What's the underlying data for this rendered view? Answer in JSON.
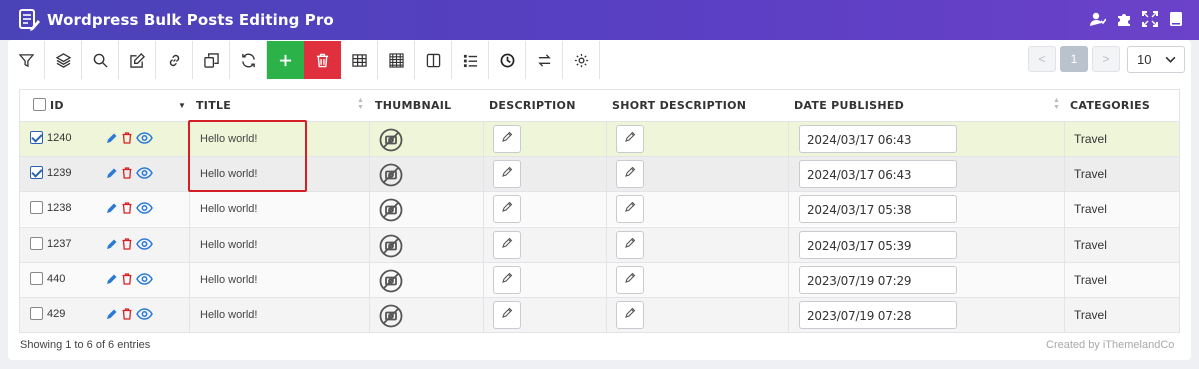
{
  "header": {
    "title": "Wordpress Bulk Posts Editing Pro",
    "icons": [
      "user-settings-icon",
      "puzzle-icon",
      "fullscreen-icon",
      "book-icon"
    ]
  },
  "toolbar": {
    "buttons": [
      "filter-icon",
      "layers-icon",
      "search-icon",
      "edit-icon",
      "link-icon",
      "duplicate-icon",
      "refresh-icon",
      "add-icon",
      "delete-icon",
      "table-icon",
      "grid-icon",
      "columns-icon",
      "list-icon",
      "clock-icon",
      "swap-icon",
      "gear-icon"
    ]
  },
  "pagination": {
    "prev": "<",
    "page": "1",
    "next": ">",
    "per_page": "10"
  },
  "table": {
    "columns": [
      "ID",
      "TITLE",
      "THUMBNAIL",
      "DESCRIPTION",
      "SHORT DESCRIPTION",
      "DATE PUBLISHED",
      "CATEGORIES"
    ],
    "rows": [
      {
        "id": "1240",
        "checked": true,
        "title": "Hello world!",
        "date": "2024/03/17 06:43",
        "category": "Travel"
      },
      {
        "id": "1239",
        "checked": true,
        "title": "Hello world!",
        "date": "2024/03/17 06:43",
        "category": "Travel"
      },
      {
        "id": "1238",
        "checked": false,
        "title": "Hello world!",
        "date": "2024/03/17 05:38",
        "category": "Travel"
      },
      {
        "id": "1237",
        "checked": false,
        "title": "Hello world!",
        "date": "2024/03/17 05:39",
        "category": "Travel"
      },
      {
        "id": "440",
        "checked": false,
        "title": "Hello world!",
        "date": "2023/07/19 07:29",
        "category": "Travel"
      },
      {
        "id": "429",
        "checked": false,
        "title": "Hello world!",
        "date": "2023/07/19 07:28",
        "category": "Travel"
      }
    ]
  },
  "footer": {
    "entries": "Showing 1 to 6 of 6 entries",
    "credit": "Created by iThemelandCo"
  },
  "colors": {
    "header": "#4a43b8",
    "add": "#2bb34a",
    "delete": "#e0303e",
    "selected_row": "#eef5d8",
    "highlight": "#d51f26"
  }
}
